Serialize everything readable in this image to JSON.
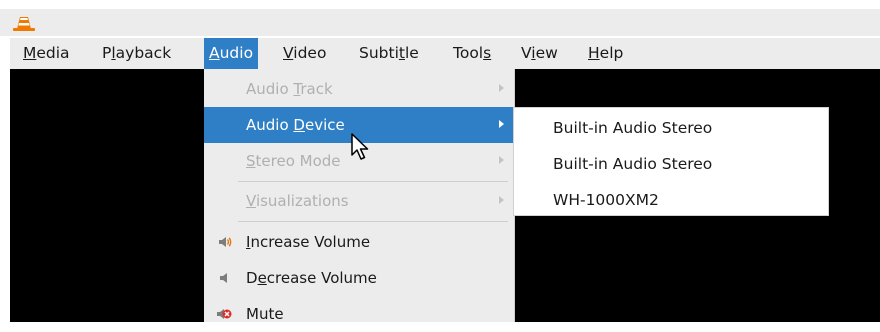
{
  "menubar": {
    "items": [
      {
        "label": "Media",
        "accel": "M",
        "rest": "edia",
        "pre": ""
      },
      {
        "label": "Playback",
        "pre": "P",
        "accel": "l",
        "rest": "ayback"
      },
      {
        "label": "Audio",
        "pre": "",
        "accel": "A",
        "rest": "udio"
      },
      {
        "label": "Video",
        "pre": "",
        "accel": "V",
        "rest": "ideo"
      },
      {
        "label": "Subtitle",
        "pre": "Subti",
        "accel": "t",
        "rest": "le"
      },
      {
        "label": "Tools",
        "pre": "Tool",
        "accel": "s",
        "rest": ""
      },
      {
        "label": "View",
        "pre": "V",
        "accel": "i",
        "rest": "ew"
      },
      {
        "label": "Help",
        "pre": "",
        "accel": "H",
        "rest": "elp"
      }
    ],
    "active": "Audio"
  },
  "audio_menu": {
    "items": [
      {
        "pre": "Audio ",
        "accel": "T",
        "rest": "rack",
        "state": "disabled",
        "submenu": true
      },
      {
        "pre": "Audio ",
        "accel": "D",
        "rest": "evice",
        "state": "highlighted",
        "submenu": true
      },
      {
        "pre": "",
        "accel": "S",
        "rest": "tereo Mode",
        "state": "disabled",
        "submenu": true
      },
      {
        "pre": "",
        "accel": "V",
        "rest": "isualizations",
        "state": "disabled",
        "submenu": true
      },
      {
        "pre": "",
        "accel": "I",
        "rest": "ncrease Volume",
        "state": "enabled",
        "icon": "volume-up-icon"
      },
      {
        "pre": "D",
        "accel": "e",
        "rest": "crease Volume",
        "state": "enabled",
        "icon": "volume-down-icon"
      },
      {
        "pre": "",
        "accel": "",
        "rest": "Mute",
        "state": "enabled",
        "icon": "mute-icon"
      }
    ]
  },
  "audio_device_submenu": {
    "items": [
      "Built-in Audio Stereo",
      "Built-in Audio Stereo",
      "WH-1000XM2"
    ]
  },
  "colors": {
    "highlight": "#2f7fc6",
    "menu_bg": "#ececec",
    "disabled_text": "#b0b0b0",
    "video_bg": "#000000"
  }
}
